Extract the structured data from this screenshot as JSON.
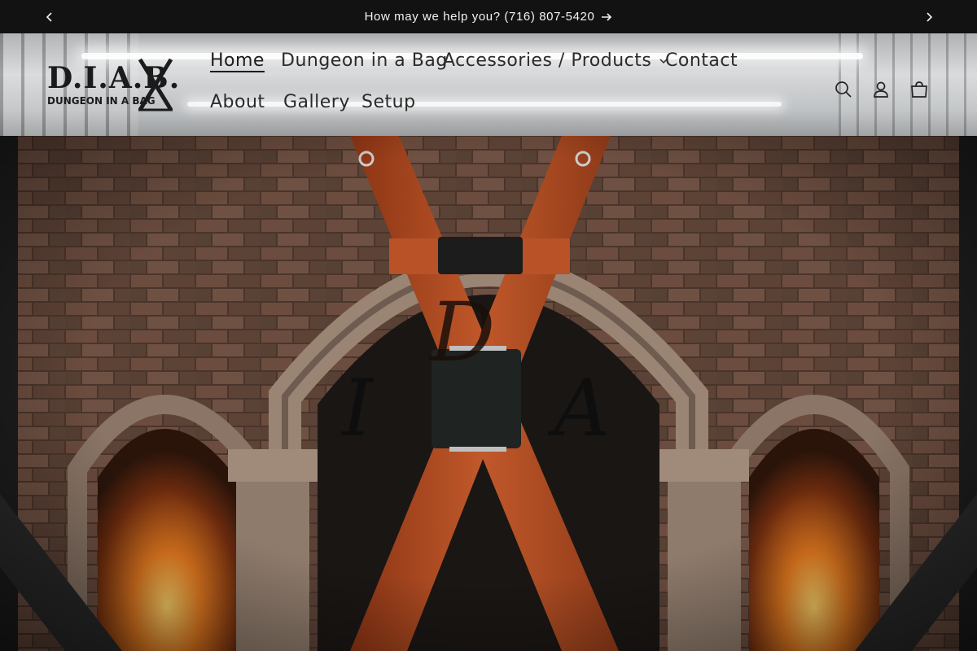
{
  "announcement": {
    "text": "How may we help you? (716) 807-5420"
  },
  "logo": {
    "line1": "D.I.A.B.",
    "line2": "DUNGEON IN A BAG"
  },
  "nav": {
    "items": [
      {
        "label": "Home",
        "active": true
      },
      {
        "label": "Dungeon in a Bag"
      },
      {
        "label": "Accessories / Products",
        "has_dropdown": true
      },
      {
        "label": "Contact"
      },
      {
        "label": "About"
      },
      {
        "label": "Gallery"
      },
      {
        "label": "Setup"
      }
    ]
  },
  "header_icons": [
    "search-icon",
    "account-icon",
    "cart-icon"
  ],
  "hero": {
    "letters": [
      "D",
      "I",
      "A"
    ]
  },
  "colors": {
    "announcement_bg": "#121212",
    "wood": "#a64a22",
    "brick": "#5a4034"
  }
}
